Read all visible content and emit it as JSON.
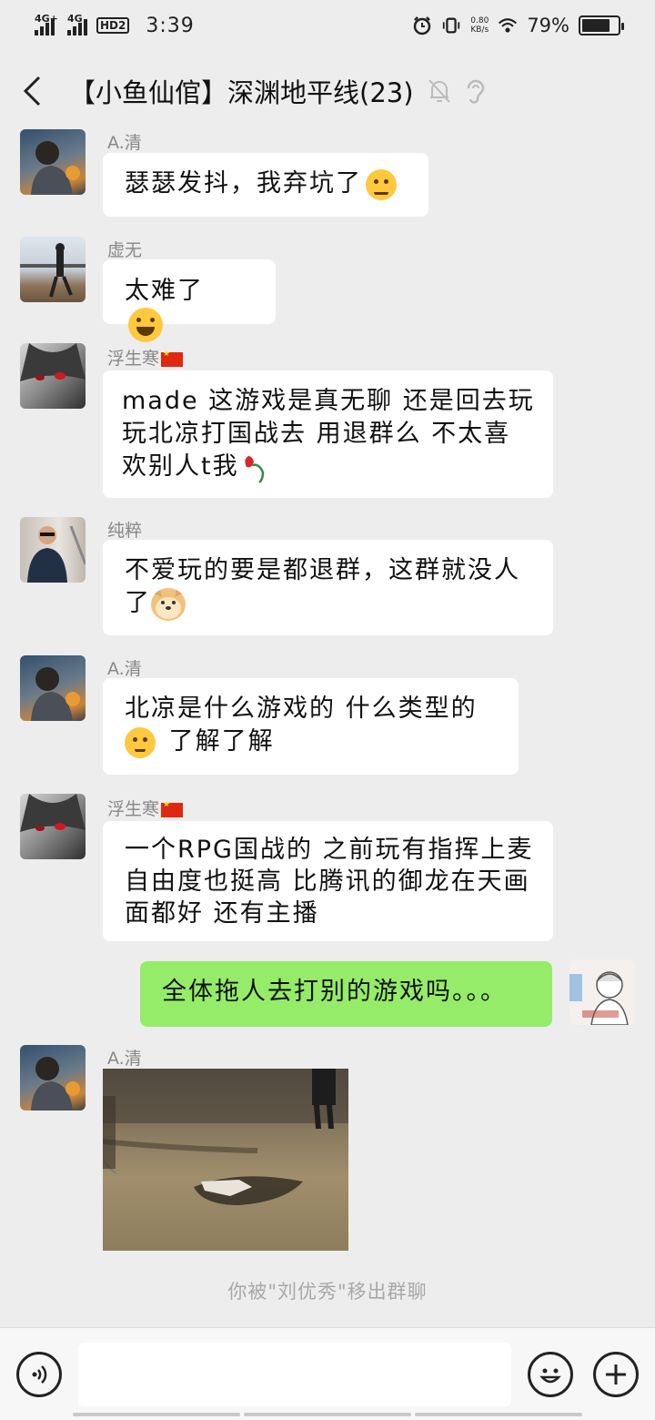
{
  "status_bar": {
    "net1": "4G+",
    "net2": "4G",
    "hd": "HD2",
    "time": "3:39",
    "speed_value": "0.80",
    "speed_unit": "KB/s",
    "battery": "79%",
    "battery_level": 0.79
  },
  "header": {
    "title": "【小鱼仙倌】深渊地平线(23)"
  },
  "messages": [
    {
      "sender": "A.清",
      "text": "瑟瑟发抖，我弃坑了"
    },
    {
      "sender": "虚无",
      "text": "太难了 "
    },
    {
      "sender": "浮生寒",
      "text": "made  这游戏是真无聊  还是回去玩玩北凉打国战去  用退群么  不太喜欢别人t我"
    },
    {
      "sender": "纯粹",
      "text": "不爱玩的要是都退群，这群就没人了"
    },
    {
      "sender": "A.清",
      "text_1": "北凉是什么游戏的 什么类型的",
      "text_2": " 了解了解"
    },
    {
      "sender": "浮生寒",
      "text": "一个RPG国战的  之前玩有指挥上麦  自由度也挺高  比腾讯的御龙在天画面都好  还有主播"
    },
    {
      "text": "全体拖人去打别的游戏吗。。。"
    },
    {
      "sender": "A.清"
    }
  ],
  "system_message": "你被\"刘优秀\"移出群聊",
  "colors": {
    "background": "#ededed",
    "my_bubble": "#95ec69",
    "other_bubble": "#ffffff"
  }
}
